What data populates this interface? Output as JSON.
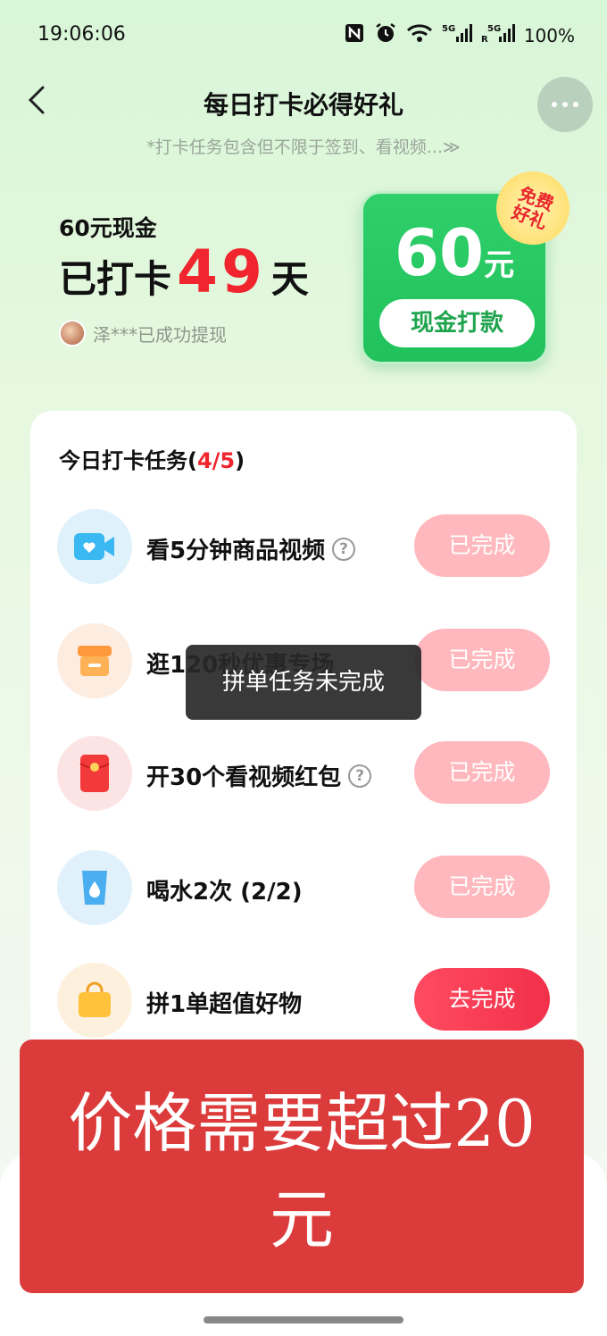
{
  "status_bar": {
    "time": "19:06:06",
    "battery": "100%",
    "net1": "5G",
    "net2": "5G"
  },
  "header": {
    "title": "每日打卡必得好礼",
    "subtitle": "*打卡任务包含但不限于签到、看视频...≫"
  },
  "hero": {
    "reward_label": "60元现金",
    "days_prefix": "已打卡",
    "days_count": "49",
    "days_suffix": "天",
    "winner_text": "泽***已成功提现",
    "cash_amount": "60",
    "cash_unit": "元",
    "cash_button": "现金打款",
    "badge_line1": "免费",
    "badge_line2": "好礼"
  },
  "tasks": {
    "title": "今日打卡任务",
    "progress_open": "(",
    "progress_done": "4/5",
    "progress_close": ")",
    "items": [
      {
        "label": "看5分钟商品视频",
        "button": "已完成",
        "icon": "video-icon",
        "help": "?"
      },
      {
        "label": "逛120秒优惠专场",
        "button": "已完成",
        "icon": "shop-icon"
      },
      {
        "label": "开30个看视频红包",
        "button": "已完成",
        "icon": "red-envelope-icon",
        "help": "?"
      },
      {
        "label": "喝水2次 (2/2)",
        "button": "已完成",
        "icon": "water-cup-icon"
      },
      {
        "label": "拼1单超值好物",
        "button": "去完成",
        "icon": "shopping-bag-icon"
      }
    ]
  },
  "toast": {
    "text": "拼单任务未完成"
  },
  "banner": {
    "text": "价格需要超过20元"
  },
  "colors": {
    "accent_red": "#f0252d",
    "green": "#21c15c",
    "done_pink": "#ffb8bd",
    "banner_red": "#dc3b3b"
  }
}
